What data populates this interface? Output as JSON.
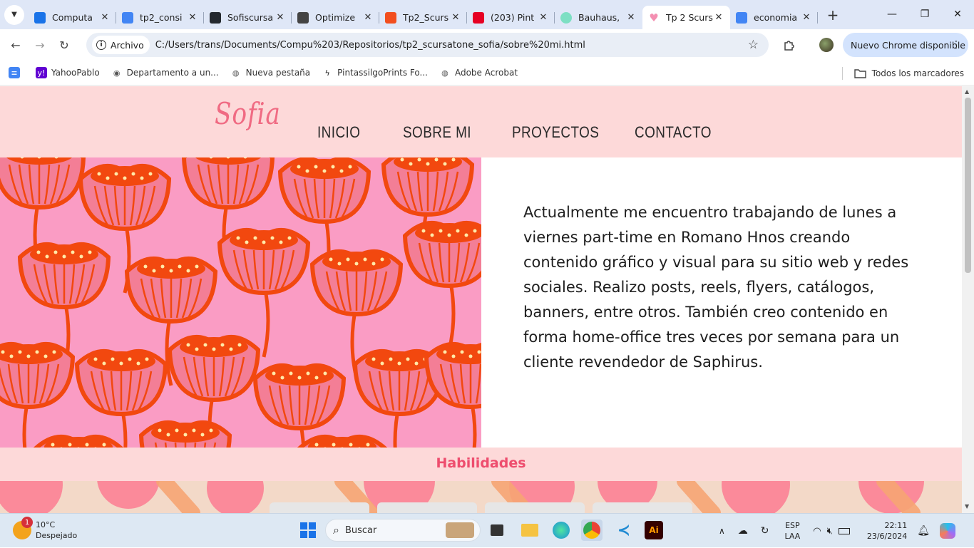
{
  "browser": {
    "tabs": [
      {
        "title": "Computa",
        "icon": "edge-c-icon",
        "color": "#1a73e8"
      },
      {
        "title": "tp2_consi",
        "icon": "docs-icon",
        "color": "#4285f4"
      },
      {
        "title": "Sofiscursa",
        "icon": "github-icon",
        "color": "#24292f"
      },
      {
        "title": "Optimize",
        "icon": "openai-icon",
        "color": "#444444"
      },
      {
        "title": "Tp2_Scurs",
        "icon": "figma-icon",
        "color": "#f24e1e"
      },
      {
        "title": "(203) Pint",
        "icon": "pinterest-icon",
        "color": "#e60023"
      },
      {
        "title": "Bauhaus, ",
        "icon": "circle-icon",
        "color": "#7ddfc3"
      },
      {
        "title": "Tp 2 Scurs",
        "icon": "heart-icon",
        "color": "#f48fb1"
      },
      {
        "title": "economia",
        "icon": "google-icon",
        "color": "#4285f4"
      }
    ],
    "active_tab_index": 7,
    "omnibox": {
      "security_chip": "Archivo",
      "url": "C:/Users/trans/Documents/Compu%203/Repositorios/tp2_scursatone_sofia/sobre%20mi.html"
    },
    "update_chip": "Nuevo Chrome disponible",
    "bookmarks": [
      {
        "label": "",
        "icon": "docs-bookmark-icon"
      },
      {
        "label": "YahooPablo",
        "icon": "yahoo-icon"
      },
      {
        "label": "Departamento a un...",
        "icon": "eye-icon"
      },
      {
        "label": "Nueva pestaña",
        "icon": "globe-icon"
      },
      {
        "label": "PintassilgoPrints Fo...",
        "icon": "bolt-icon"
      },
      {
        "label": "Adobe Acrobat",
        "icon": "globe-icon"
      }
    ],
    "all_bookmarks": "Todos los marcadores"
  },
  "site": {
    "logo": "Sofia",
    "nav": [
      "INICIO",
      "SOBRE MI",
      "PROYECTOS",
      "CONTACTO"
    ],
    "about_text": "Actualmente me encuentro trabajando de lunes a viernes part-time en Romano Hnos creando contenido gráfico y visual para su sitio web y redes sociales. Realizo posts, reels, flyers, catálogos, banners, entre otros. También creo contenido en forma home-office tres veces por semana para un cliente revendedor de Saphirus.",
    "skills_title": "Habilidades",
    "colors": {
      "header_bg": "#fdd9d9",
      "accent": "#ee4d6e",
      "logo": "#f06b83",
      "pattern_bg": "#fa9cc4",
      "flower": "#f2480f"
    }
  },
  "taskbar": {
    "weather_temp": "10°C",
    "weather_desc": "Despejado",
    "weather_badge": "1",
    "search_placeholder": "Buscar",
    "lang_top": "ESP",
    "lang_bottom": "LAA",
    "time": "22:11",
    "date": "23/6/2024"
  }
}
